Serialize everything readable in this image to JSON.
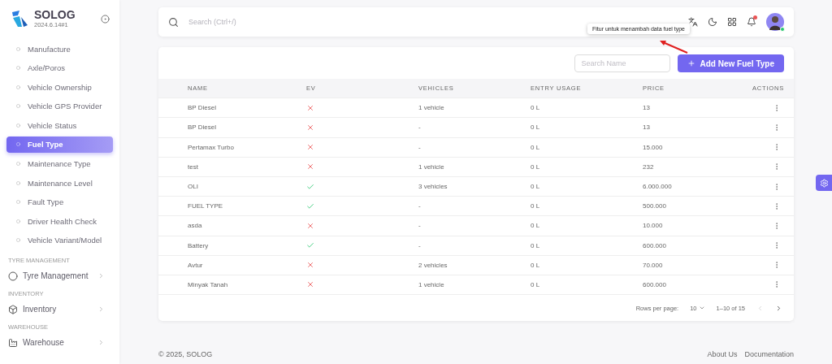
{
  "brand": {
    "name": "SOLOG",
    "version": "2024.6.14#1"
  },
  "sidebar": {
    "items": [
      {
        "kind": "link",
        "label": "Manufacture",
        "selected": false
      },
      {
        "kind": "link",
        "label": "Axle/Poros",
        "selected": false
      },
      {
        "kind": "link",
        "label": "Vehicle Ownership",
        "selected": false
      },
      {
        "kind": "link",
        "label": "Vehicle GPS Provider",
        "selected": false
      },
      {
        "kind": "link",
        "label": "Vehicle Status",
        "selected": false
      },
      {
        "kind": "link",
        "label": "Fuel Type",
        "selected": true
      },
      {
        "kind": "link",
        "label": "Maintenance Type",
        "selected": false
      },
      {
        "kind": "link",
        "label": "Maintenance Level",
        "selected": false
      },
      {
        "kind": "link",
        "label": "Fault Type",
        "selected": false
      },
      {
        "kind": "link",
        "label": "Driver Health Check",
        "selected": false
      },
      {
        "kind": "link",
        "label": "Vehicle Variant/Model",
        "selected": false
      },
      {
        "kind": "heading",
        "label": "TYRE MANAGEMENT"
      },
      {
        "kind": "group",
        "label": "Tyre Management"
      },
      {
        "kind": "heading",
        "label": "INVENTORY"
      },
      {
        "kind": "group",
        "label": "Inventory"
      },
      {
        "kind": "heading",
        "label": "WAREHOUSE"
      },
      {
        "kind": "group",
        "label": "Warehouse"
      }
    ]
  },
  "search": {
    "placeholder": "Search (Ctrl+/)"
  },
  "tooltip": {
    "text": "Fitur untuk menambah data fuel type"
  },
  "table": {
    "search_placeholder": "Search Name",
    "add_button": "Add New Fuel Type",
    "columns": [
      "NAME",
      "EV",
      "VEHICLES",
      "ENTRY USAGE",
      "PRICE",
      "ACTIONS"
    ],
    "rows": [
      {
        "name": "BP Diesel",
        "ev": false,
        "vehicles": "1 vehicle",
        "usage": "0 L",
        "price": "13"
      },
      {
        "name": "BP Diesel",
        "ev": false,
        "vehicles": "-",
        "usage": "0 L",
        "price": "13"
      },
      {
        "name": "Pertamax Turbo",
        "ev": false,
        "vehicles": "-",
        "usage": "0 L",
        "price": "15.000"
      },
      {
        "name": "test",
        "ev": false,
        "vehicles": "1 vehicle",
        "usage": "0 L",
        "price": "232"
      },
      {
        "name": "OLI",
        "ev": true,
        "vehicles": "3 vehicles",
        "usage": "0 L",
        "price": "6.000.000"
      },
      {
        "name": "FUEL TYPE",
        "ev": true,
        "vehicles": "-",
        "usage": "0 L",
        "price": "500.000"
      },
      {
        "name": "asda",
        "ev": false,
        "vehicles": "-",
        "usage": "0 L",
        "price": "10.000"
      },
      {
        "name": "Battery",
        "ev": true,
        "vehicles": "-",
        "usage": "0 L",
        "price": "600.000"
      },
      {
        "name": "Avtur",
        "ev": false,
        "vehicles": "2 vehicles",
        "usage": "0 L",
        "price": "70.000"
      },
      {
        "name": "Minyak Tanah",
        "ev": false,
        "vehicles": "1 vehicle",
        "usage": "0 L",
        "price": "600.000"
      }
    ],
    "pagination": {
      "rows_label": "Rows per page:",
      "rows_value": "10",
      "range": "1–10 of 15"
    }
  },
  "footer": {
    "copyright": "© 2025, SOLOG",
    "links": [
      "About Us",
      "Documentation"
    ]
  }
}
